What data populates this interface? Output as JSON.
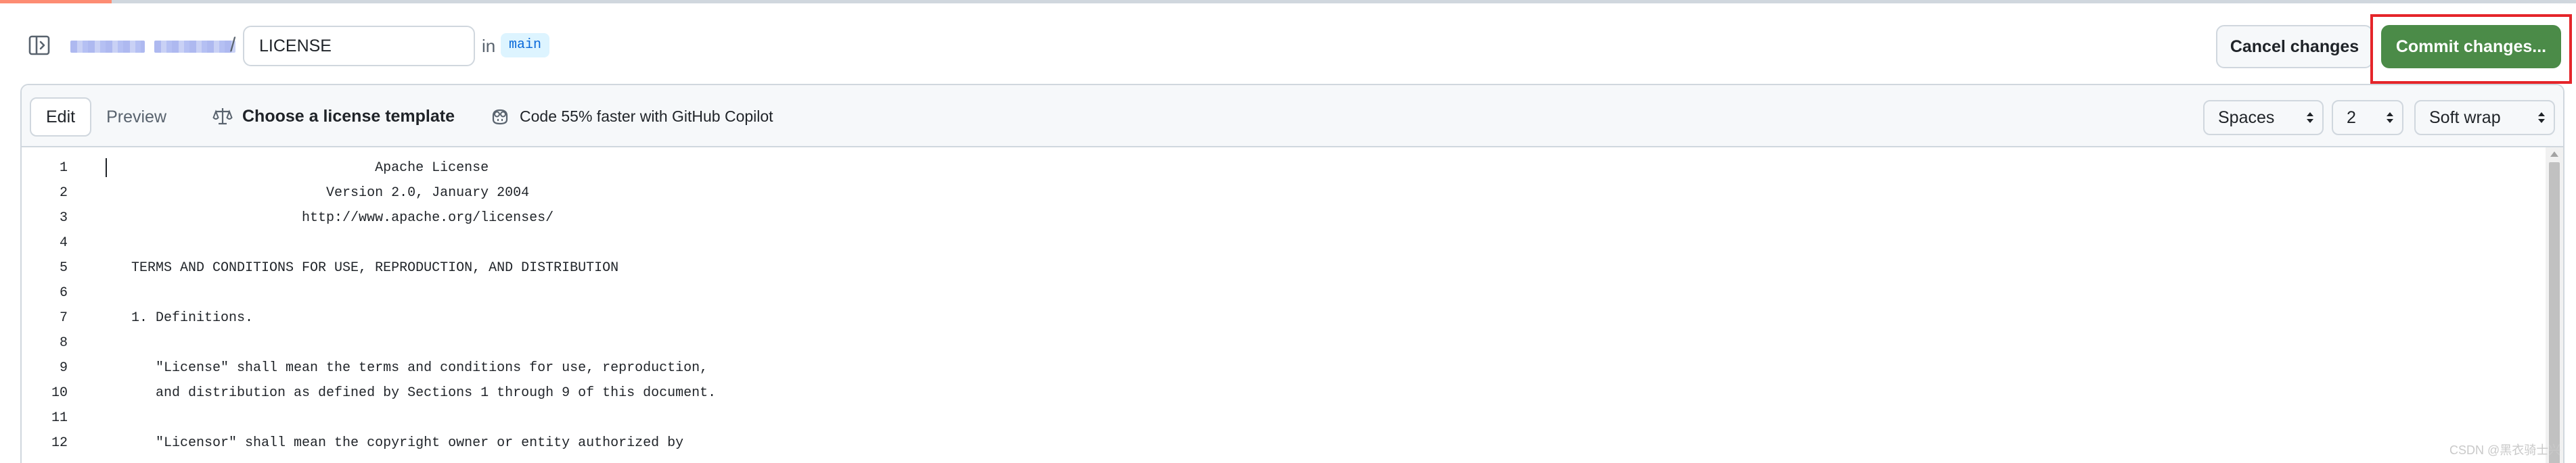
{
  "header": {
    "path_separator": "/",
    "filename_value": "LICENSE",
    "in_label": "in",
    "branch": "main",
    "cancel_label": "Cancel changes",
    "commit_label": "Commit changes..."
  },
  "toolbar": {
    "tabs": [
      {
        "label": "Edit",
        "active": true
      },
      {
        "label": "Preview",
        "active": false
      }
    ],
    "license_template_label": "Choose a license template",
    "copilot_label": "Code 55% faster with GitHub Copilot",
    "indent_mode": "Spaces",
    "indent_size": "2",
    "wrap_mode": "Soft wrap"
  },
  "code": {
    "lines": [
      {
        "n": "1",
        "t": "                                 Apache License"
      },
      {
        "n": "2",
        "t": "                           Version 2.0, January 2004"
      },
      {
        "n": "3",
        "t": "                        http://www.apache.org/licenses/"
      },
      {
        "n": "4",
        "t": ""
      },
      {
        "n": "5",
        "t": "   TERMS AND CONDITIONS FOR USE, REPRODUCTION, AND DISTRIBUTION"
      },
      {
        "n": "6",
        "t": ""
      },
      {
        "n": "7",
        "t": "   1. Definitions."
      },
      {
        "n": "8",
        "t": ""
      },
      {
        "n": "9",
        "t": "      \"License\" shall mean the terms and conditions for use, reproduction,"
      },
      {
        "n": "10",
        "t": "      and distribution as defined by Sections 1 through 9 of this document."
      },
      {
        "n": "11",
        "t": ""
      },
      {
        "n": "12",
        "t": "      \"Licensor\" shall mean the copyright owner or entity authorized by"
      }
    ]
  },
  "watermark": "CSDN @黑衣骑士兴",
  "colors": {
    "commit_button": "#4b8b48",
    "highlight_box": "#e5252a",
    "branch_text": "#0969da",
    "branch_bg": "#ddf4ff"
  },
  "icons": {
    "sidebar_toggle": "sidebar-expand-icon",
    "license": "law-scale-icon",
    "copilot": "copilot-icon",
    "select_caret": "up-down-caret-icon"
  }
}
